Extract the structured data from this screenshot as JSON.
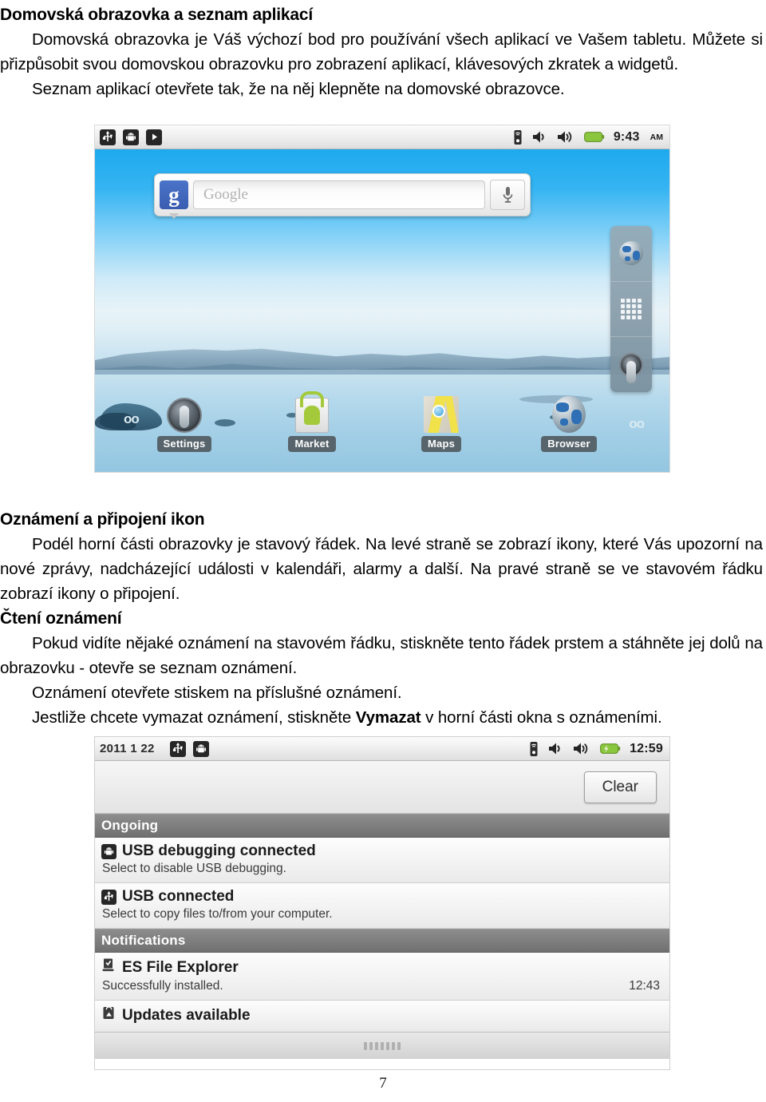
{
  "document": {
    "heading1": "Domovská obrazovka a seznam aplikací",
    "para1": "Domovská obrazovka je Váš výchozí bod pro používání všech aplikací ve Vašem tabletu. Můžete si přizpůsobit svou domovskou obrazovku pro zobrazení aplikací, klávesových zkratek a widgetů.",
    "para2": "Seznam aplikací otevřete tak, že na něj klepněte na domovské obrazovce.",
    "heading2": "Oznámení a připojení ikon",
    "para3": "Podél horní části obrazovky je stavový řádek. Na levé straně se zobrazí ikony, které Vás upozorní na nové zprávy, nadcházející události v kalendáři, alarmy a další. Na pravé straně se ve stavovém řádku zobrazí ikony o připojení.",
    "heading3": "Čtení oznámení",
    "para4": "Pokud vidíte nějaké oznámení na stavovém řádku, stiskněte tento řádek prstem a stáhněte jej dolů na obrazovku - otevře se seznam oznámení.",
    "para5": "Oznámení otevřete stiskem na příslušné oznámení.",
    "para6_before": "Jestliže chcete vymazat oznámení, stiskněte ",
    "para6_bold": "Vymazat",
    "para6_after": " v horní části okna s oznámeními.",
    "page_number": "7"
  },
  "home_screen": {
    "status_bar": {
      "left_icons": [
        "usb-icon",
        "android-icon",
        "play-icon"
      ],
      "right_icons": [
        "signal-icon",
        "volume-icon",
        "volume-ring-icon",
        "battery-icon"
      ],
      "time": "9:43",
      "ampm": "AM"
    },
    "search_widget": {
      "logo": "g",
      "placeholder": "Google",
      "mic": "microphone-icon"
    },
    "side_panel": {
      "items": [
        "browser-globe-icon",
        "app-grid-icon",
        "settings-icon"
      ]
    },
    "dock": [
      {
        "label": "Settings",
        "icon": "settings-icon"
      },
      {
        "label": "Market",
        "icon": "market-bag-icon"
      },
      {
        "label": "Maps",
        "icon": "maps-icon"
      },
      {
        "label": "Browser",
        "icon": "browser-globe-icon"
      }
    ]
  },
  "notification_panel": {
    "status_bar": {
      "date": "2011 1 22",
      "left_icons": [
        "usb-icon",
        "android-icon"
      ],
      "right_icons": [
        "signal-icon",
        "volume-icon",
        "volume-ring-icon",
        "battery-charging-icon"
      ],
      "time": "12:59"
    },
    "clear_button": "Clear",
    "sections": [
      {
        "title": "Ongoing",
        "items": [
          {
            "icon": "android-icon",
            "title": "USB debugging connected",
            "subtitle": "Select to disable USB debugging.",
            "time": ""
          },
          {
            "icon": "usb-icon",
            "title": "USB connected",
            "subtitle": "Select to copy files to/from your computer.",
            "time": ""
          }
        ]
      },
      {
        "title": "Notifications",
        "items": [
          {
            "icon": "download-done-icon",
            "title": "ES File Explorer",
            "subtitle": "Successfully installed.",
            "time": "12:43"
          },
          {
            "icon": "market-update-icon",
            "title": "Updates available",
            "subtitle": "",
            "time": ""
          }
        ]
      }
    ]
  },
  "colors": {
    "sky": "#1ea9ee",
    "google_blue": "#3a5db0",
    "market_green": "#a4c93a",
    "battery_green": "#8bc63f",
    "section_gray": "#7d7d7d"
  }
}
